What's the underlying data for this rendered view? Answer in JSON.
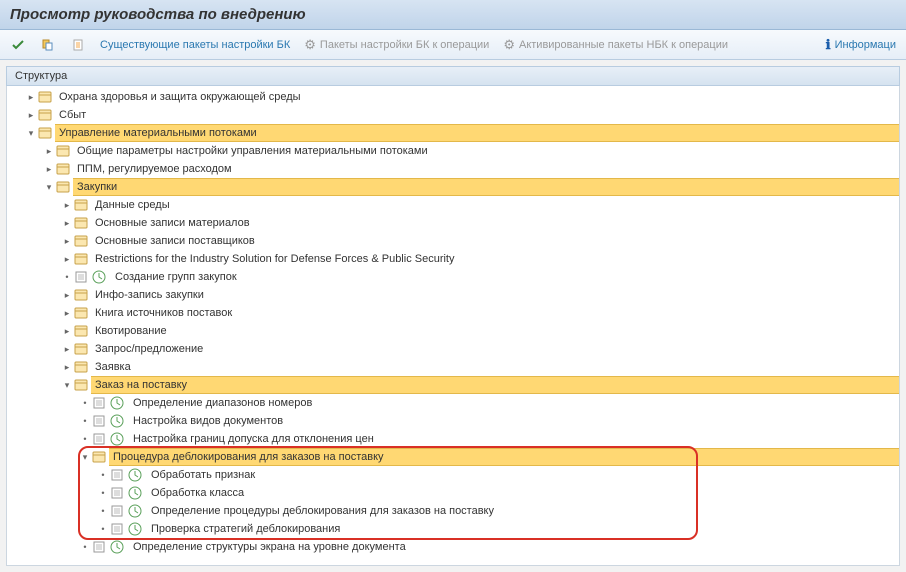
{
  "title": "Просмотр руководства по внедрению",
  "toolbar": {
    "existing_bc": "Существующие пакеты настройки БК",
    "bc_to_op": "Пакеты настройки БК к операции",
    "nbc_to_op": "Активированные пакеты НБК к операции",
    "info": "Информаци"
  },
  "panel_header": "Структура",
  "tree": {
    "n1": "Охрана здоровья и защита окружающей среды",
    "n2": "Сбыт",
    "n3": "Управление материальными потоками",
    "n4": "Общие параметры настройки управления материальными потоками",
    "n5": "ППМ, регулируемое расходом",
    "n6": "Закупки",
    "n7": "Данные среды",
    "n8": "Основные записи материалов",
    "n9": "Основные записи поставщиков",
    "n10": "Restrictions for the Industry Solution for Defense Forces & Public Security",
    "n11": "Создание групп закупок",
    "n12": "Инфо-запись закупки",
    "n13": "Книга источников поставок",
    "n14": "Квотирование",
    "n15": "Запрос/предложение",
    "n16": "Заявка",
    "n17": "Заказ на поставку",
    "n18": "Определение диапазонов номеров",
    "n19": "Настройка видов документов",
    "n20": "Настройка границ допуска для отклонения цен",
    "n21": "Процедура деблокирования для заказов на поставку",
    "n22": "Обработать признак",
    "n23": "Обработка класса",
    "n24": "Определение процедуры деблокирования для заказов на поставку",
    "n25": "Проверка стратегий деблокирования",
    "n26": "Определение структуры экрана на уровне документа"
  }
}
